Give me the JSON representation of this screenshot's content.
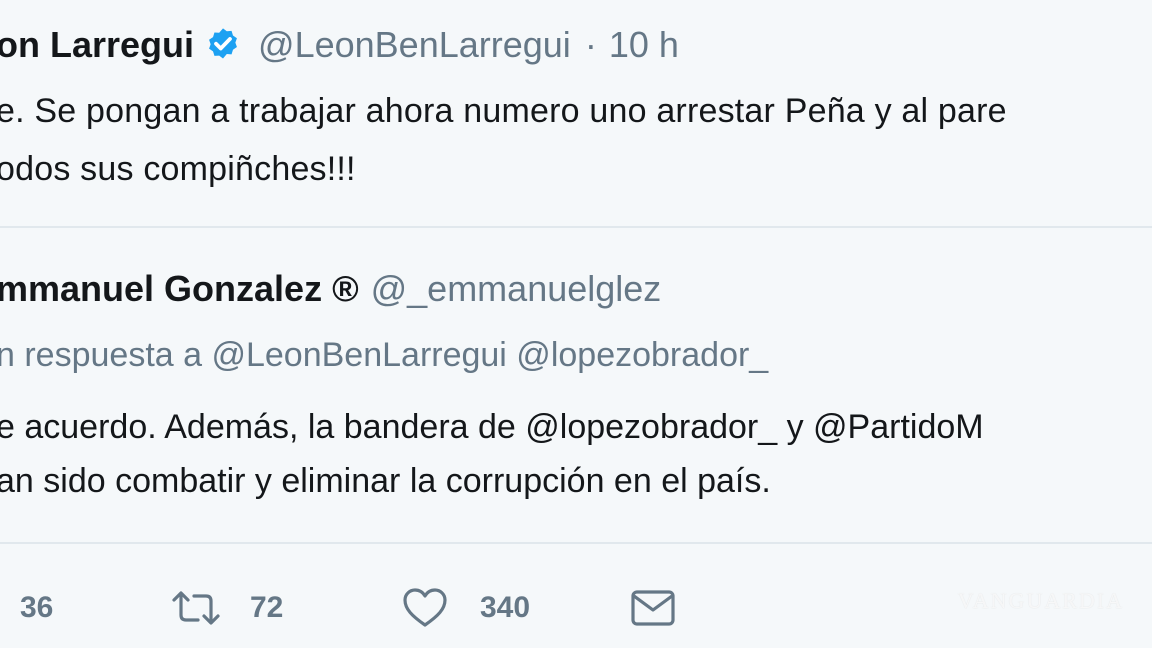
{
  "tweet": {
    "author_name": "on Larregui",
    "handle": "@LeonBenLarregui",
    "separator": "·",
    "time": "10 h",
    "text_lines": [
      "e. Se pongan a trabajar ahora numero uno arrestar Peña y al pare",
      "odos sus compiñches!!!"
    ]
  },
  "quoted": {
    "author_name": "mmanuel Gonzalez ®",
    "handle": "@_emmanuelglez",
    "reply_context": "n respuesta a @LeonBenLarregui @lopezobrador_",
    "text_lines": [
      "e acuerdo. Además, la bandera de @lopezobrador_ y @PartidoM",
      "an sido combatir y eliminar la corrupción en el país."
    ]
  },
  "actions": {
    "reply_count": "36",
    "retweet_count": "72",
    "like_count": "340"
  },
  "watermark": "VANGUARDIA",
  "colors": {
    "background": "#f5f8fa",
    "text_primary": "#14171a",
    "text_secondary": "#657786",
    "verified_blue": "#1da1f2",
    "divider": "#e1e8ed"
  },
  "icons": [
    "verified-badge-icon",
    "retweet-icon",
    "heart-icon",
    "mail-icon"
  ]
}
